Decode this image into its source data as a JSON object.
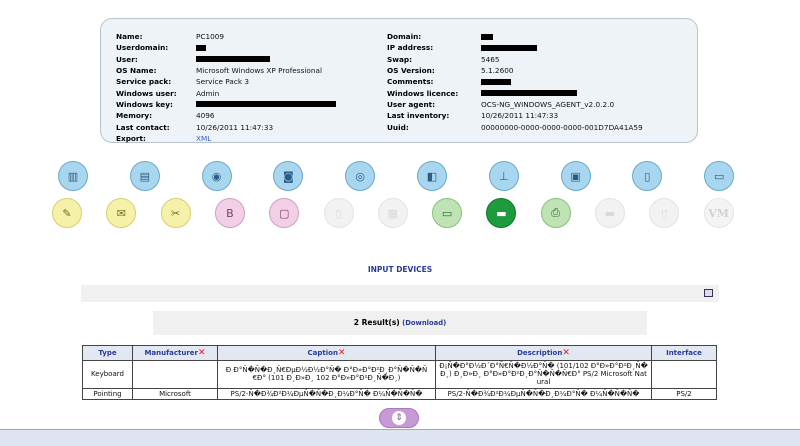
{
  "info": {
    "left": [
      {
        "label": "Name:",
        "value": "PC1009"
      },
      {
        "label": "Userdomain:",
        "redact": 10
      },
      {
        "label": "User:",
        "redact": 74
      },
      {
        "label": "OS Name:",
        "value": "Microsoft Windows XP Professional"
      },
      {
        "label": "Service pack:",
        "value": "Service Pack 3"
      },
      {
        "label": "Windows user:",
        "value": "Admin"
      },
      {
        "label": "Windows key:",
        "redact": 140
      },
      {
        "label": "Memory:",
        "value": "4096"
      },
      {
        "label": "Last contact:",
        "value": "10/26/2011 11:47:33"
      },
      {
        "label": "Export:",
        "value": "XML",
        "link": true
      }
    ],
    "right": [
      {
        "label": "Domain:",
        "redact": 12
      },
      {
        "label": "IP address:",
        "redact": 56
      },
      {
        "label": "Swap:",
        "value": "5465"
      },
      {
        "label": "OS Version:",
        "value": "5.1.2600"
      },
      {
        "label": "Comments:",
        "redact": 30
      },
      {
        "label": "Windows licence:",
        "redact": 96
      },
      {
        "label": "User agent:",
        "value": "OCS-NG_WINDOWS_AGENT_v2.0.2.0"
      },
      {
        "label": "Last inventory:",
        "value": "10/26/2011 11:47:33"
      },
      {
        "label": "Uuid:",
        "value": "00000000-0000-0000-0000-001D7DA41A59"
      }
    ]
  },
  "icons_top": [
    {
      "name": "bios-icon",
      "glyph": "▥",
      "style": "blue"
    },
    {
      "name": "memory-icon",
      "glyph": "▤",
      "style": "blue"
    },
    {
      "name": "storage-icon",
      "glyph": "◉",
      "style": "blue"
    },
    {
      "name": "drive-icon",
      "glyph": "◙",
      "style": "blue"
    },
    {
      "name": "video-icon",
      "glyph": "◎",
      "style": "blue"
    },
    {
      "name": "sound-icon",
      "glyph": "◧",
      "style": "blue"
    },
    {
      "name": "network-icon",
      "glyph": "⊥",
      "style": "blue"
    },
    {
      "name": "controller-icon",
      "glyph": "▣",
      "style": "blue"
    },
    {
      "name": "slots-icon",
      "glyph": "▯",
      "style": "blue"
    },
    {
      "name": "ports-icon",
      "glyph": "▭",
      "style": "blue"
    }
  ],
  "icons_bottom": [
    {
      "name": "software-icon",
      "glyph": "✎",
      "style": "yellow"
    },
    {
      "name": "registry-icon",
      "glyph": "✉",
      "style": "yellow"
    },
    {
      "name": "settings-icon",
      "glyph": "✂",
      "style": "yellow"
    },
    {
      "name": "bios-chip-icon",
      "glyph": "B",
      "style": "pink"
    },
    {
      "name": "folder-icon",
      "glyph": "▢",
      "style": "pink"
    },
    {
      "name": "disabled-icon-1",
      "glyph": "▯",
      "style": "grey"
    },
    {
      "name": "disabled-icon-2",
      "glyph": "▦",
      "style": "grey"
    },
    {
      "name": "monitor-icon",
      "glyph": "▭",
      "style": "green"
    },
    {
      "name": "input-devices-icon",
      "glyph": "▬",
      "style": "dkgreen"
    },
    {
      "name": "printer-icon",
      "glyph": "⎙",
      "style": "green"
    },
    {
      "name": "disabled-icon-3",
      "glyph": "▬",
      "style": "grey"
    },
    {
      "name": "disabled-icon-4",
      "glyph": "▯",
      "style": "grey"
    },
    {
      "name": "virtual-machine-icon",
      "glyph": "VM",
      "style": "vm"
    }
  ],
  "section": {
    "title": "INPUT DEVICES"
  },
  "results": {
    "count_text": "2 Result(s)",
    "download_label": "(Download)"
  },
  "table": {
    "headers": [
      "Type",
      "Manufacturer",
      "Caption",
      "Description",
      "Interface"
    ],
    "delete_marker": "✕",
    "rows": [
      {
        "type": "Keyboard",
        "manufacturer": "",
        "caption": "Ð Ð°Ñ�Ñ�Ð¸Ñ€ÐµÐ½Ð½Ð°Ñ� Ð°Ð»Ð°Ð²Ð¸Ð°Ñ�Ñ�Ñ€Ð° (101 Ð¸Ð»Ð¸ 102 Ð°Ð»Ð°Ð²Ð¸Ñ�Ð¸)",
        "description": "Ð¡Ñ�Ð°Ð½Ð´Ð°Ñ€Ñ�Ð½Ð°Ñ� (101/102 Ð°Ð»Ð°Ð²Ð¸Ñ�Ð¸) Ð¸Ð»Ð¸ Ð°Ð»Ð°Ð²Ð¸Ð°Ñ�Ñ�Ñ€Ð° PS/2 Microsoft Natural",
        "interface": ""
      },
      {
        "type": "Pointing",
        "manufacturer": "Microsoft",
        "caption": "PS/2-Ñ�Ð¾Ð²Ð¼ÐµÑ�Ñ�Ð¸Ð¼Ð°Ñ� Ð¼Ñ�Ñ�Ñ�",
        "description": "PS/2-Ñ�Ð¾Ð²Ð¼ÐµÑ�Ñ�Ð¸Ð¼Ð°Ñ� Ð¼Ñ�Ñ�Ñ�",
        "interface": "PS/2"
      }
    ]
  },
  "scroll": {
    "glyph": "⇕"
  }
}
